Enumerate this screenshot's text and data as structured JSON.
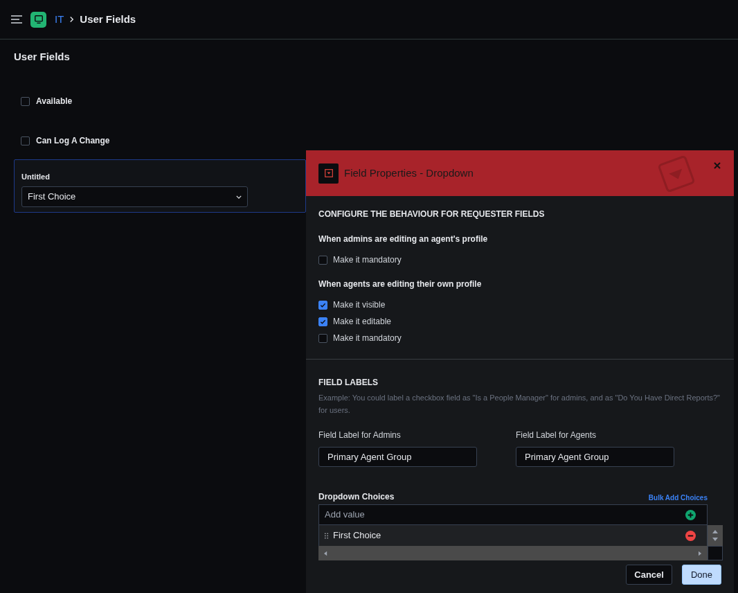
{
  "breadcrumb": {
    "parent": "IT",
    "current": "User Fields"
  },
  "page_title": "User Fields",
  "fields": [
    {
      "kind": "checkbox",
      "label": "Available",
      "checked": false
    },
    {
      "kind": "checkbox",
      "label": "Can Log A Change",
      "checked": false
    },
    {
      "kind": "dropdown",
      "label": "Untitled",
      "value": "First Choice",
      "selected": true
    }
  ],
  "panel": {
    "title": "Field Properties - Dropdown",
    "section_heading": "CONFIGURE THE BEHAVIOUR FOR REQUESTER FIELDS",
    "groups": [
      {
        "heading": "When admins are editing an agent's profile",
        "options": [
          {
            "label": "Make it mandatory",
            "checked": false
          }
        ]
      },
      {
        "heading": "When agents are editing their own profile",
        "options": [
          {
            "label": "Make it visible",
            "checked": true
          },
          {
            "label": "Make it editable",
            "checked": true
          },
          {
            "label": "Make it mandatory",
            "checked": false
          }
        ]
      }
    ],
    "labels_heading": "FIELD LABELS",
    "labels_hint": "Example: You could label a checkbox field as \"Is a People Manager\" for admins, and as \"Do You Have Direct Reports?\" for users.",
    "label_fields": [
      {
        "label": "Field Label for Admins",
        "value": "Primary Agent Group"
      },
      {
        "label": "Field Label for Agents",
        "value": "Primary Agent Group"
      }
    ],
    "choices_heading": "Dropdown Choices",
    "bulk_add": "Bulk Add Choices",
    "add_placeholder": "Add value",
    "choices": [
      "First Choice"
    ],
    "buttons": {
      "cancel": "Cancel",
      "done": "Done"
    }
  }
}
